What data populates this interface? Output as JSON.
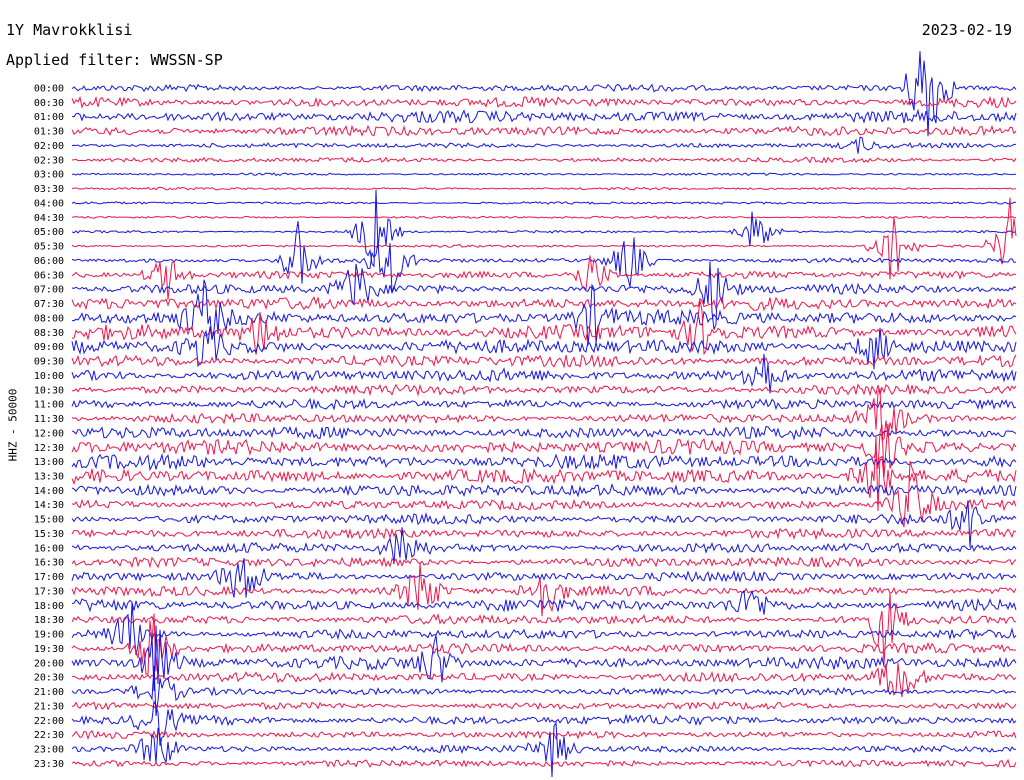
{
  "header": {
    "station": "1Y Mavrokklisi",
    "date": "2023-02-19",
    "filter_text": "Applied filter: WWSSN-SP",
    "channel_label": "HHZ - 50000"
  },
  "chart_data": {
    "type": "line",
    "title": "1Y Mavrokklisi",
    "xlabel": "",
    "ylabel": "HHZ - 50000",
    "grid": false,
    "legend": "none",
    "colors": [
      "#1414e6",
      "#f0144a"
    ],
    "row_labels": [
      "00:00",
      "00:30",
      "01:00",
      "01:30",
      "02:00",
      "02:30",
      "03:00",
      "03:30",
      "04:00",
      "04:30",
      "05:00",
      "05:30",
      "06:00",
      "06:30",
      "07:00",
      "07:30",
      "08:00",
      "08:30",
      "09:00",
      "09:30",
      "10:00",
      "10:30",
      "11:00",
      "11:30",
      "12:00",
      "12:30",
      "13:00",
      "13:30",
      "14:00",
      "14:30",
      "15:00",
      "15:30",
      "16:00",
      "16:30",
      "17:00",
      "17:30",
      "18:00",
      "18:30",
      "19:00",
      "19:30",
      "20:00",
      "20:30",
      "21:00",
      "21:30",
      "22:00",
      "22:30",
      "23:00",
      "23:30"
    ],
    "noise_level": [
      3,
      4,
      5,
      4,
      2,
      2,
      1,
      1,
      1,
      1,
      1,
      1,
      2,
      3,
      4,
      5,
      6,
      6,
      6,
      5,
      5,
      4,
      4,
      4,
      5,
      6,
      6,
      6,
      5,
      4,
      4,
      4,
      4,
      4,
      4,
      4,
      5,
      4,
      4,
      4,
      5,
      4,
      3,
      3,
      4,
      3,
      3,
      3
    ],
    "events": [
      {
        "row": 0,
        "x": 0.905,
        "amp": 90
      },
      {
        "row": 4,
        "x": 0.835,
        "amp": 8
      },
      {
        "row": 10,
        "x": 0.32,
        "amp": 50
      },
      {
        "row": 10,
        "x": 0.725,
        "amp": 30
      },
      {
        "row": 11,
        "x": 0.87,
        "amp": 45
      },
      {
        "row": 11,
        "x": 0.995,
        "amp": 55
      },
      {
        "row": 12,
        "x": 0.24,
        "amp": 40
      },
      {
        "row": 12,
        "x": 0.335,
        "amp": 45
      },
      {
        "row": 12,
        "x": 0.59,
        "amp": 35
      },
      {
        "row": 13,
        "x": 0.1,
        "amp": 28
      },
      {
        "row": 13,
        "x": 0.55,
        "amp": 30
      },
      {
        "row": 14,
        "x": 0.3,
        "amp": 35
      },
      {
        "row": 14,
        "x": 0.68,
        "amp": 40
      },
      {
        "row": 16,
        "x": 0.14,
        "amp": 35
      },
      {
        "row": 16,
        "x": 0.55,
        "amp": 32
      },
      {
        "row": 17,
        "x": 0.2,
        "amp": 30
      },
      {
        "row": 17,
        "x": 0.665,
        "amp": 30
      },
      {
        "row": 18,
        "x": 0.14,
        "amp": 28
      },
      {
        "row": 18,
        "x": 0.85,
        "amp": 25
      },
      {
        "row": 20,
        "x": 0.73,
        "amp": 35
      },
      {
        "row": 23,
        "x": 0.86,
        "amp": 40
      },
      {
        "row": 25,
        "x": 0.86,
        "amp": 30
      },
      {
        "row": 27,
        "x": 0.85,
        "amp": 45
      },
      {
        "row": 29,
        "x": 0.89,
        "amp": 50
      },
      {
        "row": 30,
        "x": 0.95,
        "amp": 30
      },
      {
        "row": 32,
        "x": 0.35,
        "amp": 30
      },
      {
        "row": 34,
        "x": 0.18,
        "amp": 35
      },
      {
        "row": 35,
        "x": 0.37,
        "amp": 40
      },
      {
        "row": 35,
        "x": 0.5,
        "amp": 35
      },
      {
        "row": 36,
        "x": 0.72,
        "amp": 22
      },
      {
        "row": 37,
        "x": 0.86,
        "amp": 45
      },
      {
        "row": 38,
        "x": 0.06,
        "amp": 40
      },
      {
        "row": 39,
        "x": 0.085,
        "amp": 45
      },
      {
        "row": 40,
        "x": 0.09,
        "amp": 40
      },
      {
        "row": 40,
        "x": 0.385,
        "amp": 30
      },
      {
        "row": 41,
        "x": 0.875,
        "amp": 35
      },
      {
        "row": 42,
        "x": 0.09,
        "amp": 30
      },
      {
        "row": 44,
        "x": 0.09,
        "amp": 30
      },
      {
        "row": 46,
        "x": 0.09,
        "amp": 35
      },
      {
        "row": 46,
        "x": 0.51,
        "amp": 30
      }
    ]
  }
}
